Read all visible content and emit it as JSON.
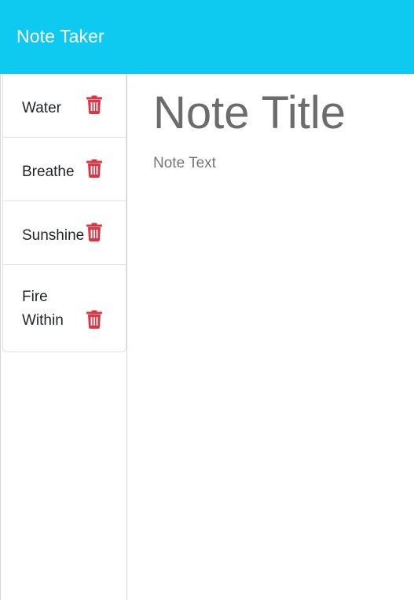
{
  "app": {
    "brand": "Note Taker"
  },
  "notes": [
    {
      "title": "Water",
      "icon": "trash-icon"
    },
    {
      "title": "Breathe",
      "icon": "trash-icon"
    },
    {
      "title": "Sunshine",
      "icon": "trash-icon"
    },
    {
      "title": "Fire Within",
      "icon": "trash-icon"
    }
  ],
  "editor": {
    "title_placeholder": "Note Title",
    "text_placeholder": "Note Text"
  },
  "colors": {
    "navbar": "#0fcaf0",
    "delete_icon": "#dc3545"
  }
}
